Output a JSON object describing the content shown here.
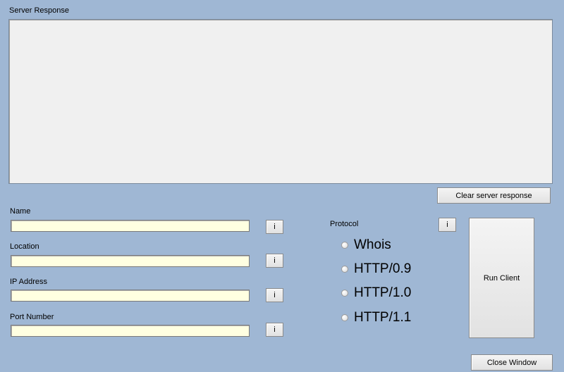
{
  "server_response": {
    "label": "Server Response",
    "content": "",
    "clear_button": "Clear server response"
  },
  "fields": {
    "name": {
      "label": "Name",
      "value": "",
      "info": "i"
    },
    "location": {
      "label": "Location",
      "value": "",
      "info": "i"
    },
    "ip_address": {
      "label": "IP Address",
      "value": "",
      "info": "i"
    },
    "port_number": {
      "label": "Port Number",
      "value": "",
      "info": "i"
    }
  },
  "protocol": {
    "label": "Protocol",
    "info": "i",
    "options": [
      "Whois",
      "HTTP/0.9",
      "HTTP/1.0",
      "HTTP/1.1"
    ]
  },
  "buttons": {
    "run_client": "Run Client",
    "close_window": "Close Window"
  },
  "colors": {
    "background": "#9fb7d4",
    "input_background": "#ffffe1",
    "response_background": "#f0f0f0"
  }
}
